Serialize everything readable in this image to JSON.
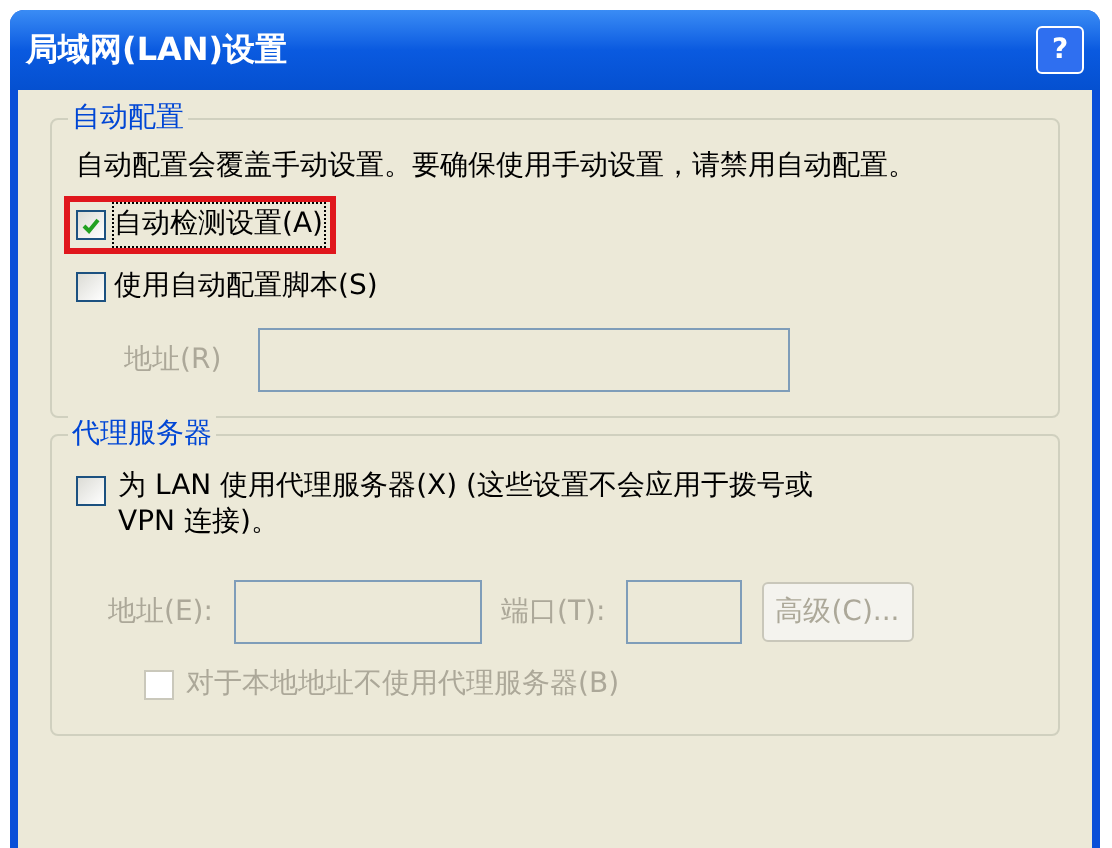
{
  "window": {
    "title": "局域网(LAN)设置",
    "help_button": "?"
  },
  "auto_config": {
    "title": "自动配置",
    "description": "自动配置会覆盖手动设置。要确保使用手动设置，请禁用自动配置。",
    "options": [
      {
        "label": "自动检测设置(A)",
        "checked": true,
        "highlighted": true,
        "focused": true
      },
      {
        "label": "使用自动配置脚本(S)",
        "checked": false,
        "highlighted": false,
        "focused": false
      }
    ],
    "address": {
      "label": "地址(R)",
      "disabled": true
    }
  },
  "proxy": {
    "title": "代理服务器",
    "use_proxy": {
      "label": "为 LAN 使用代理服务器(X) (这些设置不会应用于拨号或 VPN 连接)。",
      "checked": false
    },
    "address": {
      "label": "地址(E):",
      "disabled": true
    },
    "port": {
      "label": "端口(T):",
      "disabled": true
    },
    "advanced_button": {
      "label": "高级(C)...",
      "disabled": true
    },
    "bypass": {
      "label": "对于本地地址不使用代理服务器(B)",
      "checked": false,
      "disabled": true
    }
  }
}
